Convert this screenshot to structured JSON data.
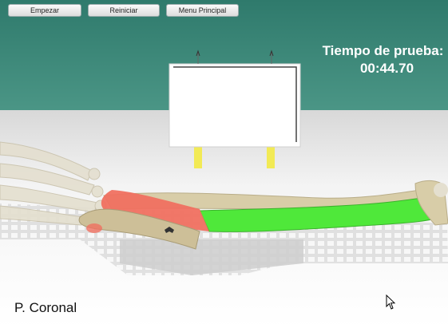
{
  "toolbar": {
    "start_label": "Empezar",
    "restart_label": "Reiniciar",
    "menu_label": "Menu Principal"
  },
  "timer": {
    "label": "Tiempo de prueba:",
    "value": "00:44.70"
  },
  "view": {
    "label": "P. Coronal"
  },
  "colors": {
    "wall": "#3f8a7a",
    "floor": "#f2f2f2",
    "bone": "#d8cda8",
    "bone_green": "#4fe83a",
    "bone_red": "#f07060",
    "support_post": "#f2ea55"
  },
  "icons": [
    "cursor-arrow-icon"
  ]
}
